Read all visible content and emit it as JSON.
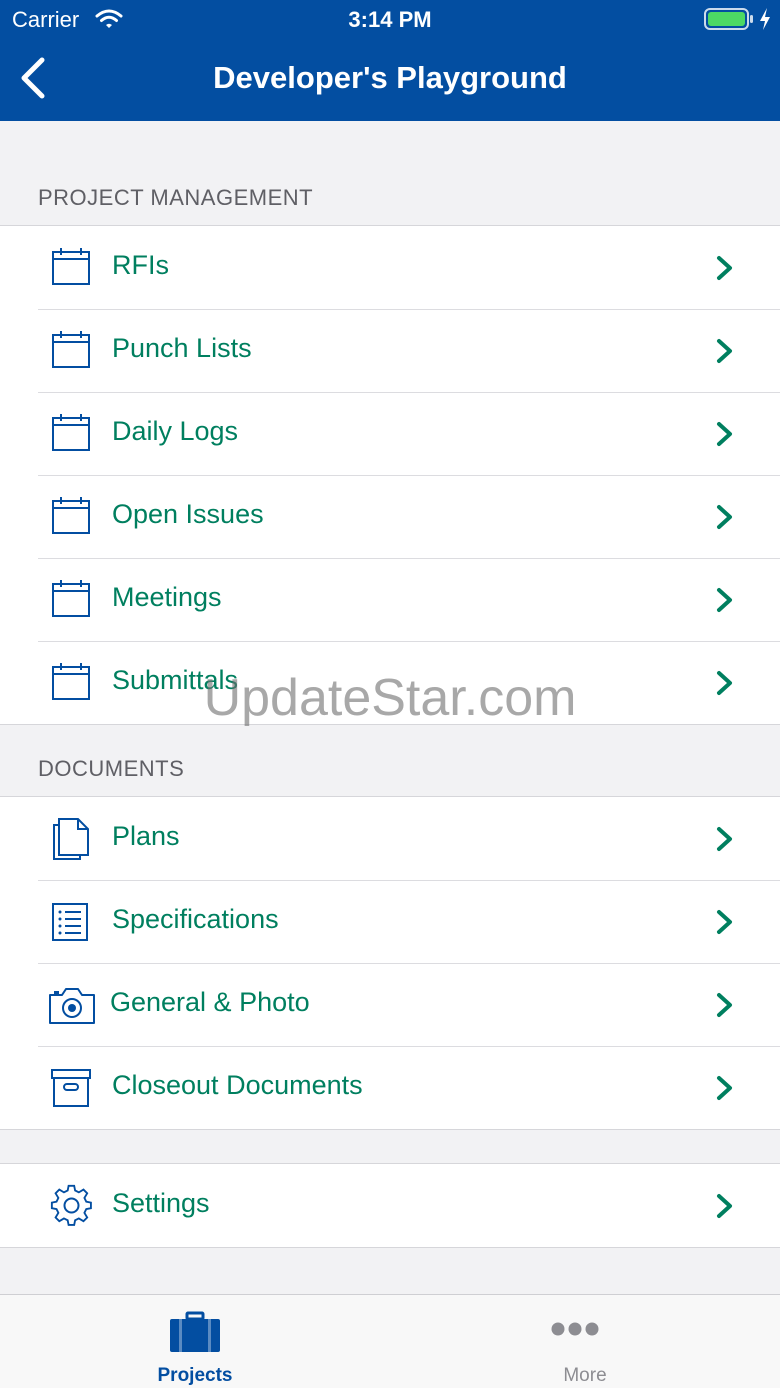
{
  "status_bar": {
    "carrier": "Carrier",
    "time": "3:14 PM"
  },
  "nav": {
    "title": "Developer's Playground"
  },
  "sections": {
    "project_management": {
      "title": "PROJECT MANAGEMENT",
      "items": [
        {
          "label": "RFIs",
          "icon": "calendar-icon"
        },
        {
          "label": "Punch Lists",
          "icon": "calendar-icon"
        },
        {
          "label": "Daily Logs",
          "icon": "calendar-icon"
        },
        {
          "label": "Open Issues",
          "icon": "calendar-icon"
        },
        {
          "label": "Meetings",
          "icon": "calendar-icon"
        },
        {
          "label": "Submittals",
          "icon": "calendar-icon"
        }
      ]
    },
    "documents": {
      "title": "DOCUMENTS",
      "items": [
        {
          "label": "Plans",
          "icon": "documents-icon"
        },
        {
          "label": "Specifications",
          "icon": "list-icon"
        },
        {
          "label": "General & Photo",
          "icon": "camera-icon"
        },
        {
          "label": "Closeout Documents",
          "icon": "archive-box-icon"
        }
      ]
    },
    "other": {
      "items": [
        {
          "label": "Settings",
          "icon": "gear-icon"
        }
      ]
    }
  },
  "watermark": "UpdateStar.com",
  "tabbar": {
    "projects": "Projects",
    "more": "More"
  },
  "colors": {
    "nav_bg": "#034ea1",
    "accent_green": "#007f5f",
    "icon_blue": "#034ea1"
  }
}
